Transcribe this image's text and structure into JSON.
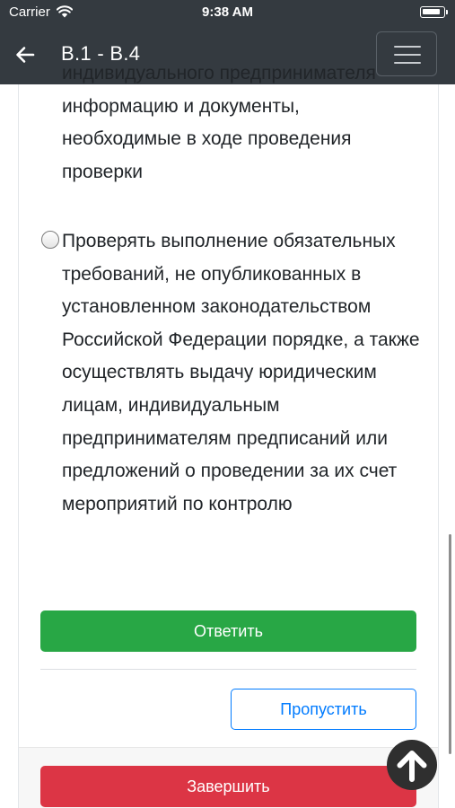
{
  "status_bar": {
    "carrier": "Carrier",
    "time": "9:38 AM"
  },
  "navbar": {
    "title": "В.1 - В.4",
    "back_icon": "arrow-left-icon",
    "menu_icon": "hamburger-icon"
  },
  "question": {
    "options": [
      {
        "text": "индивидуального предпринимателя информацию и документы, необходимые в ходе проведения проверки",
        "selected": false
      },
      {
        "text": "Проверять выполнение обязательных требований, не опубликованных в установленном законодательством Российской Федерации порядке, а также осуществлять выдачу юридическим лицам, индивидуальным предпринимателям предписаний или предложений о проведении за их счет мероприятий по контролю",
        "selected": false
      }
    ]
  },
  "actions": {
    "answer_label": "Ответить",
    "skip_label": "Пропустить",
    "finish_label": "Завершить"
  },
  "colors": {
    "bar": "#343a40",
    "answer": "#28a745",
    "skip": "#007bff",
    "finish": "#dc3545"
  },
  "scroll_top_icon": "arrow-up-circle-icon"
}
